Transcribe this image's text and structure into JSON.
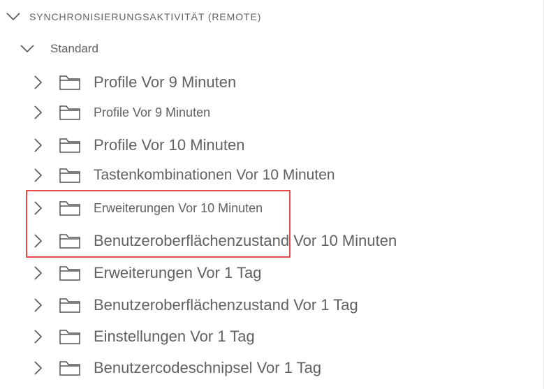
{
  "section": {
    "title": "SYNCHRONISIERUNGSAKTIVITÄT (REMOTE)",
    "expanded": true
  },
  "group": {
    "label": "Standard",
    "expanded": true
  },
  "items": [
    {
      "label": "Profile Vor 9 Minuten"
    },
    {
      "label": "Profile Vor 9 Minuten"
    },
    {
      "label": "Profile Vor 10 Minuten"
    },
    {
      "label": "Tastenkombinationen Vor 10 Minuten"
    },
    {
      "label": "Erweiterungen Vor 10 Minuten"
    },
    {
      "label": "Benutzeroberflächenzustand Vor 10 Minuten"
    },
    {
      "label": "Erweiterungen Vor 1 Tag"
    },
    {
      "label": "Benutzeroberflächenzustand Vor 1 Tag"
    },
    {
      "label": "Einstellungen Vor 1 Tag"
    },
    {
      "label": "Benutzercodeschnipsel Vor 1 Tag"
    }
  ],
  "colors": {
    "text": "#616161",
    "highlight_border": "#e84a4a",
    "icon": "#555555"
  }
}
